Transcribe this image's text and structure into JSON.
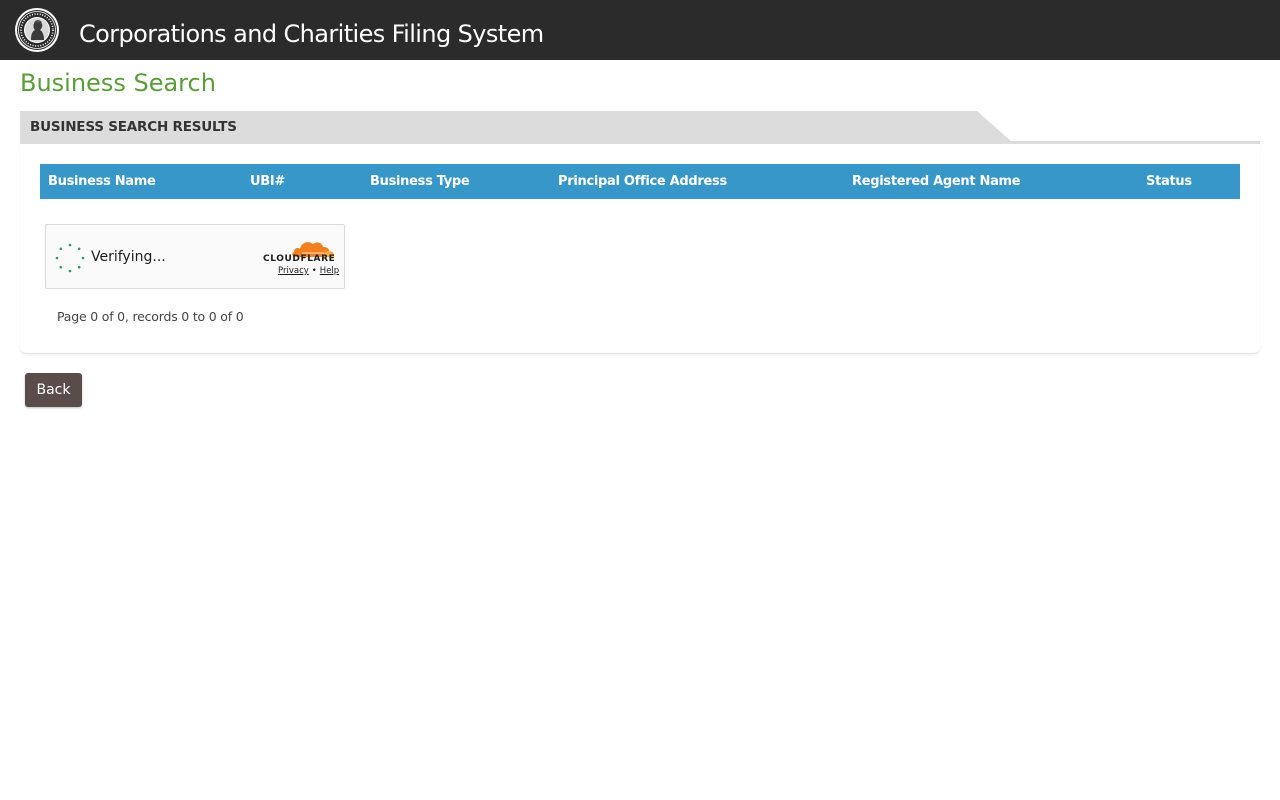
{
  "header": {
    "app_title": "Corporations and Charities Filing System",
    "seal_icon": "state-seal-icon"
  },
  "page": {
    "title": "Business Search"
  },
  "section": {
    "label": "BUSINESS SEARCH RESULTS"
  },
  "table": {
    "columns": [
      "Business Name",
      "UBI#",
      "Business Type",
      "Principal Office Address",
      "Registered Agent Name",
      "Status"
    ],
    "rows": []
  },
  "captcha": {
    "status_text": "Verifying...",
    "brand": "CLOUDFLARE",
    "privacy_label": "Privacy",
    "separator": "•",
    "help_label": "Help"
  },
  "pager": {
    "info": "Page 0 of 0, records 0 to 0 of 0"
  },
  "actions": {
    "back_label": "Back"
  },
  "colors": {
    "topbar": "#2b2b2b",
    "title_green": "#5a9e3a",
    "table_header": "#3797c9",
    "back_button": "#5b4c4c",
    "cloudflare_orange": "#f38020"
  }
}
